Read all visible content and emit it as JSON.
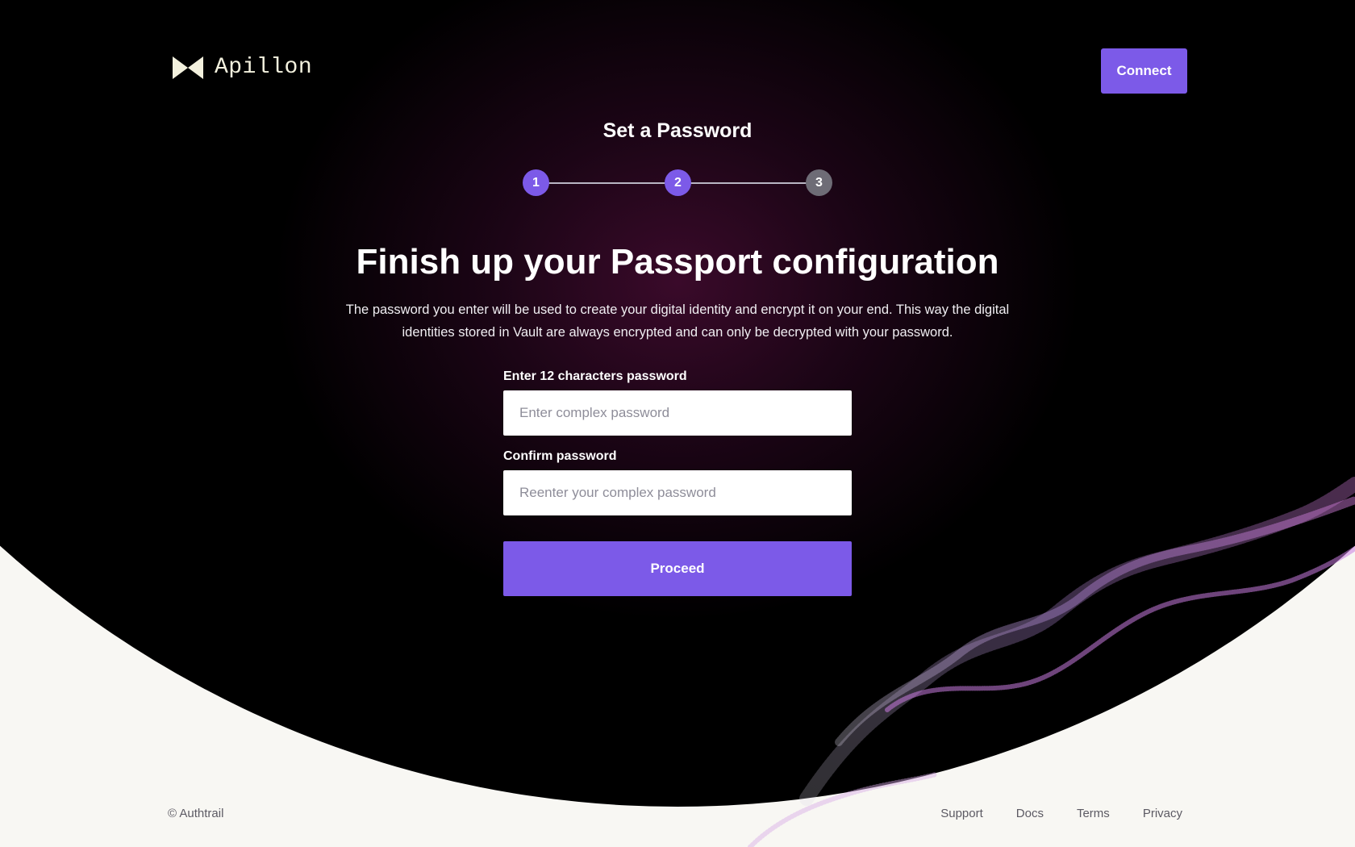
{
  "header": {
    "brand": "Apillon",
    "connect_label": "Connect"
  },
  "stepper": {
    "title": "Set a Password",
    "steps": [
      "1",
      "2",
      "3"
    ],
    "current_step": 2
  },
  "main": {
    "headline": "Finish up your Passport configuration",
    "description": "The password you enter will be used to create your digital identity and encrypt it on your end. This way the digital identities stored in Vault are always encrypted and can only be decrypted with your password."
  },
  "form": {
    "password_label": "Enter 12 characters password",
    "password_placeholder": "Enter complex password",
    "password_value": "",
    "confirm_label": "Confirm password",
    "confirm_placeholder": "Reenter your complex password",
    "confirm_value": "",
    "proceed_label": "Proceed"
  },
  "footer": {
    "copyright": "© Authtrail",
    "links": [
      "Support",
      "Docs",
      "Terms",
      "Privacy"
    ]
  },
  "colors": {
    "accent": "#7c5ae8",
    "hero_bg": "#000000",
    "page_bg": "#f8f7f3",
    "step_inactive": "#6e6c76"
  }
}
